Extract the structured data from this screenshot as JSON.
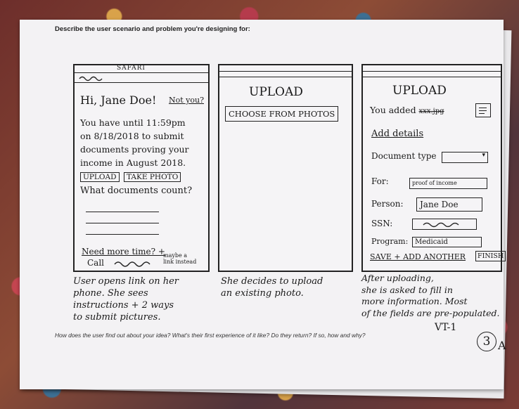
{
  "sheet": {
    "prompt_top": "Describe the user scenario and problem you're designing for:",
    "prompt_bottom": "How does the user find out about your idea? What's their first experience of it like? Do they return? If so, how and why?"
  },
  "panel1": {
    "browser_label": "SAFARI",
    "greeting": "Hi, Jane Doe!",
    "not_you": "Not you?",
    "body_lines": [
      "You have until 11:59pm",
      "on 8/18/2018 to submit",
      "documents proving your",
      "income in August 2018."
    ],
    "upload_button": "UPLOAD",
    "take_photo_button": "TAKE PHOTO",
    "what_counts": "What documents count?",
    "need_more_time": "Need more time? +",
    "call": "Call",
    "note": [
      "maybe a",
      "link instead"
    ],
    "caption": [
      "User opens link on her",
      "phone. She sees",
      "instructions + 2 ways",
      "to submit pictures."
    ]
  },
  "panel2": {
    "title": "UPLOAD",
    "choose_button": "CHOOSE FROM PHOTOS",
    "caption": [
      "She decides to upload",
      "an existing photo."
    ]
  },
  "panel3": {
    "title": "UPLOAD",
    "added_prefix": "You added",
    "added_file": "xxx.jpg",
    "add_details": "Add details",
    "doc_type_label": "Document type",
    "for_label": "For:",
    "for_value": "proof of income",
    "person_label": "Person:",
    "person_value": "Jane Doe",
    "ssn_label": "SSN:",
    "program_label": "Program:",
    "program_value": "Medicaid",
    "save_add": "SAVE + ADD ANOTHER",
    "finish": "FINISH",
    "caption": [
      "After uploading,",
      "she is asked to fill in",
      "more information. Most",
      "of the fields are pre-populated."
    ]
  },
  "marks": {
    "sheet_code": "VT-1",
    "page_number": "3",
    "page_suffix": "A"
  }
}
